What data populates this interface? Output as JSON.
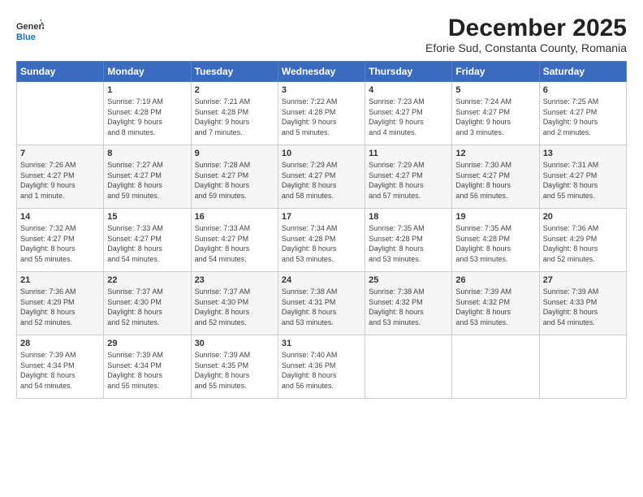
{
  "logo": {
    "general": "General",
    "blue": "Blue"
  },
  "title": "December 2025",
  "subtitle": "Eforie Sud, Constanta County, Romania",
  "days": [
    "Sunday",
    "Monday",
    "Tuesday",
    "Wednesday",
    "Thursday",
    "Friday",
    "Saturday"
  ],
  "cells": [
    [
      {
        "day": null,
        "content": ""
      },
      {
        "day": "1",
        "content": "Sunrise: 7:19 AM\nSunset: 4:28 PM\nDaylight: 9 hours\nand 8 minutes."
      },
      {
        "day": "2",
        "content": "Sunrise: 7:21 AM\nSunset: 4:28 PM\nDaylight: 9 hours\nand 7 minutes."
      },
      {
        "day": "3",
        "content": "Sunrise: 7:22 AM\nSunset: 4:28 PM\nDaylight: 9 hours\nand 5 minutes."
      },
      {
        "day": "4",
        "content": "Sunrise: 7:23 AM\nSunset: 4:27 PM\nDaylight: 9 hours\nand 4 minutes."
      },
      {
        "day": "5",
        "content": "Sunrise: 7:24 AM\nSunset: 4:27 PM\nDaylight: 9 hours\nand 3 minutes."
      },
      {
        "day": "6",
        "content": "Sunrise: 7:25 AM\nSunset: 4:27 PM\nDaylight: 9 hours\nand 2 minutes."
      }
    ],
    [
      {
        "day": "7",
        "content": "Sunrise: 7:26 AM\nSunset: 4:27 PM\nDaylight: 9 hours\nand 1 minute."
      },
      {
        "day": "8",
        "content": "Sunrise: 7:27 AM\nSunset: 4:27 PM\nDaylight: 8 hours\nand 59 minutes."
      },
      {
        "day": "9",
        "content": "Sunrise: 7:28 AM\nSunset: 4:27 PM\nDaylight: 8 hours\nand 59 minutes."
      },
      {
        "day": "10",
        "content": "Sunrise: 7:29 AM\nSunset: 4:27 PM\nDaylight: 8 hours\nand 58 minutes."
      },
      {
        "day": "11",
        "content": "Sunrise: 7:29 AM\nSunset: 4:27 PM\nDaylight: 8 hours\nand 57 minutes."
      },
      {
        "day": "12",
        "content": "Sunrise: 7:30 AM\nSunset: 4:27 PM\nDaylight: 8 hours\nand 56 minutes."
      },
      {
        "day": "13",
        "content": "Sunrise: 7:31 AM\nSunset: 4:27 PM\nDaylight: 8 hours\nand 55 minutes."
      }
    ],
    [
      {
        "day": "14",
        "content": "Sunrise: 7:32 AM\nSunset: 4:27 PM\nDaylight: 8 hours\nand 55 minutes."
      },
      {
        "day": "15",
        "content": "Sunrise: 7:33 AM\nSunset: 4:27 PM\nDaylight: 8 hours\nand 54 minutes."
      },
      {
        "day": "16",
        "content": "Sunrise: 7:33 AM\nSunset: 4:27 PM\nDaylight: 8 hours\nand 54 minutes."
      },
      {
        "day": "17",
        "content": "Sunrise: 7:34 AM\nSunset: 4:28 PM\nDaylight: 8 hours\nand 53 minutes."
      },
      {
        "day": "18",
        "content": "Sunrise: 7:35 AM\nSunset: 4:28 PM\nDaylight: 8 hours\nand 53 minutes."
      },
      {
        "day": "19",
        "content": "Sunrise: 7:35 AM\nSunset: 4:28 PM\nDaylight: 8 hours\nand 53 minutes."
      },
      {
        "day": "20",
        "content": "Sunrise: 7:36 AM\nSunset: 4:29 PM\nDaylight: 8 hours\nand 52 minutes."
      }
    ],
    [
      {
        "day": "21",
        "content": "Sunrise: 7:36 AM\nSunset: 4:29 PM\nDaylight: 8 hours\nand 52 minutes."
      },
      {
        "day": "22",
        "content": "Sunrise: 7:37 AM\nSunset: 4:30 PM\nDaylight: 8 hours\nand 52 minutes."
      },
      {
        "day": "23",
        "content": "Sunrise: 7:37 AM\nSunset: 4:30 PM\nDaylight: 8 hours\nand 52 minutes."
      },
      {
        "day": "24",
        "content": "Sunrise: 7:38 AM\nSunset: 4:31 PM\nDaylight: 8 hours\nand 53 minutes."
      },
      {
        "day": "25",
        "content": "Sunrise: 7:38 AM\nSunset: 4:32 PM\nDaylight: 8 hours\nand 53 minutes."
      },
      {
        "day": "26",
        "content": "Sunrise: 7:39 AM\nSunset: 4:32 PM\nDaylight: 8 hours\nand 53 minutes."
      },
      {
        "day": "27",
        "content": "Sunrise: 7:39 AM\nSunset: 4:33 PM\nDaylight: 8 hours\nand 54 minutes."
      }
    ],
    [
      {
        "day": "28",
        "content": "Sunrise: 7:39 AM\nSunset: 4:34 PM\nDaylight: 8 hours\nand 54 minutes."
      },
      {
        "day": "29",
        "content": "Sunrise: 7:39 AM\nSunset: 4:34 PM\nDaylight: 8 hours\nand 55 minutes."
      },
      {
        "day": "30",
        "content": "Sunrise: 7:39 AM\nSunset: 4:35 PM\nDaylight: 8 hours\nand 55 minutes."
      },
      {
        "day": "31",
        "content": "Sunrise: 7:40 AM\nSunset: 4:36 PM\nDaylight: 8 hours\nand 56 minutes."
      },
      {
        "day": null,
        "content": ""
      },
      {
        "day": null,
        "content": ""
      },
      {
        "day": null,
        "content": ""
      }
    ]
  ]
}
